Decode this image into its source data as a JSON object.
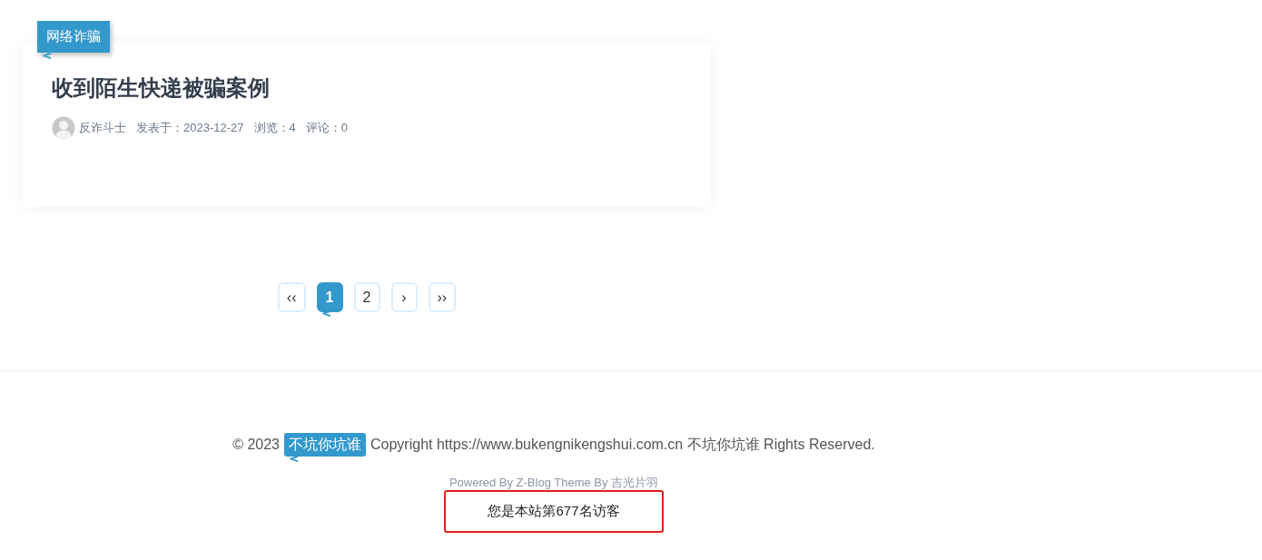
{
  "post": {
    "category": "网络诈骗",
    "title": "收到陌生快递被骗案例",
    "author": "反诈斗士",
    "meta": [
      "发表于：2023-12-27",
      "浏览：4",
      "评论：0"
    ]
  },
  "pagination": [
    {
      "label": "‹‹",
      "selected": false
    },
    {
      "label": "1",
      "selected": true
    },
    {
      "label": "2",
      "selected": false
    },
    {
      "label": "›",
      "selected": false
    },
    {
      "label": "››",
      "selected": false
    }
  ],
  "footer": {
    "copyright_prefix": "© 2023",
    "site_badge": "不坑你坑谁",
    "copyright_text": "Copyright https://www.bukengnikengshui.com.cn 不坑你坑谁 Rights Reserved.",
    "powered_by": "Powered By Z-Blog Theme By 吉光片羽",
    "visitor_counter": "您是本站第677名访客"
  }
}
